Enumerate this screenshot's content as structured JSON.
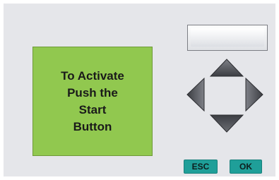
{
  "display": {
    "lines": [
      "To Activate",
      "Push the",
      "Start",
      "Button"
    ],
    "color": "#91c84f"
  },
  "buttons": {
    "blank_key": "",
    "up_arrow": "arrow-up-icon",
    "left_arrow": "arrow-left-icon",
    "right_arrow": "arrow-right-icon",
    "down_arrow": "arrow-down-icon",
    "esc_label": "ESC",
    "ok_label": "OK",
    "accent_color": "#1f9f99"
  }
}
